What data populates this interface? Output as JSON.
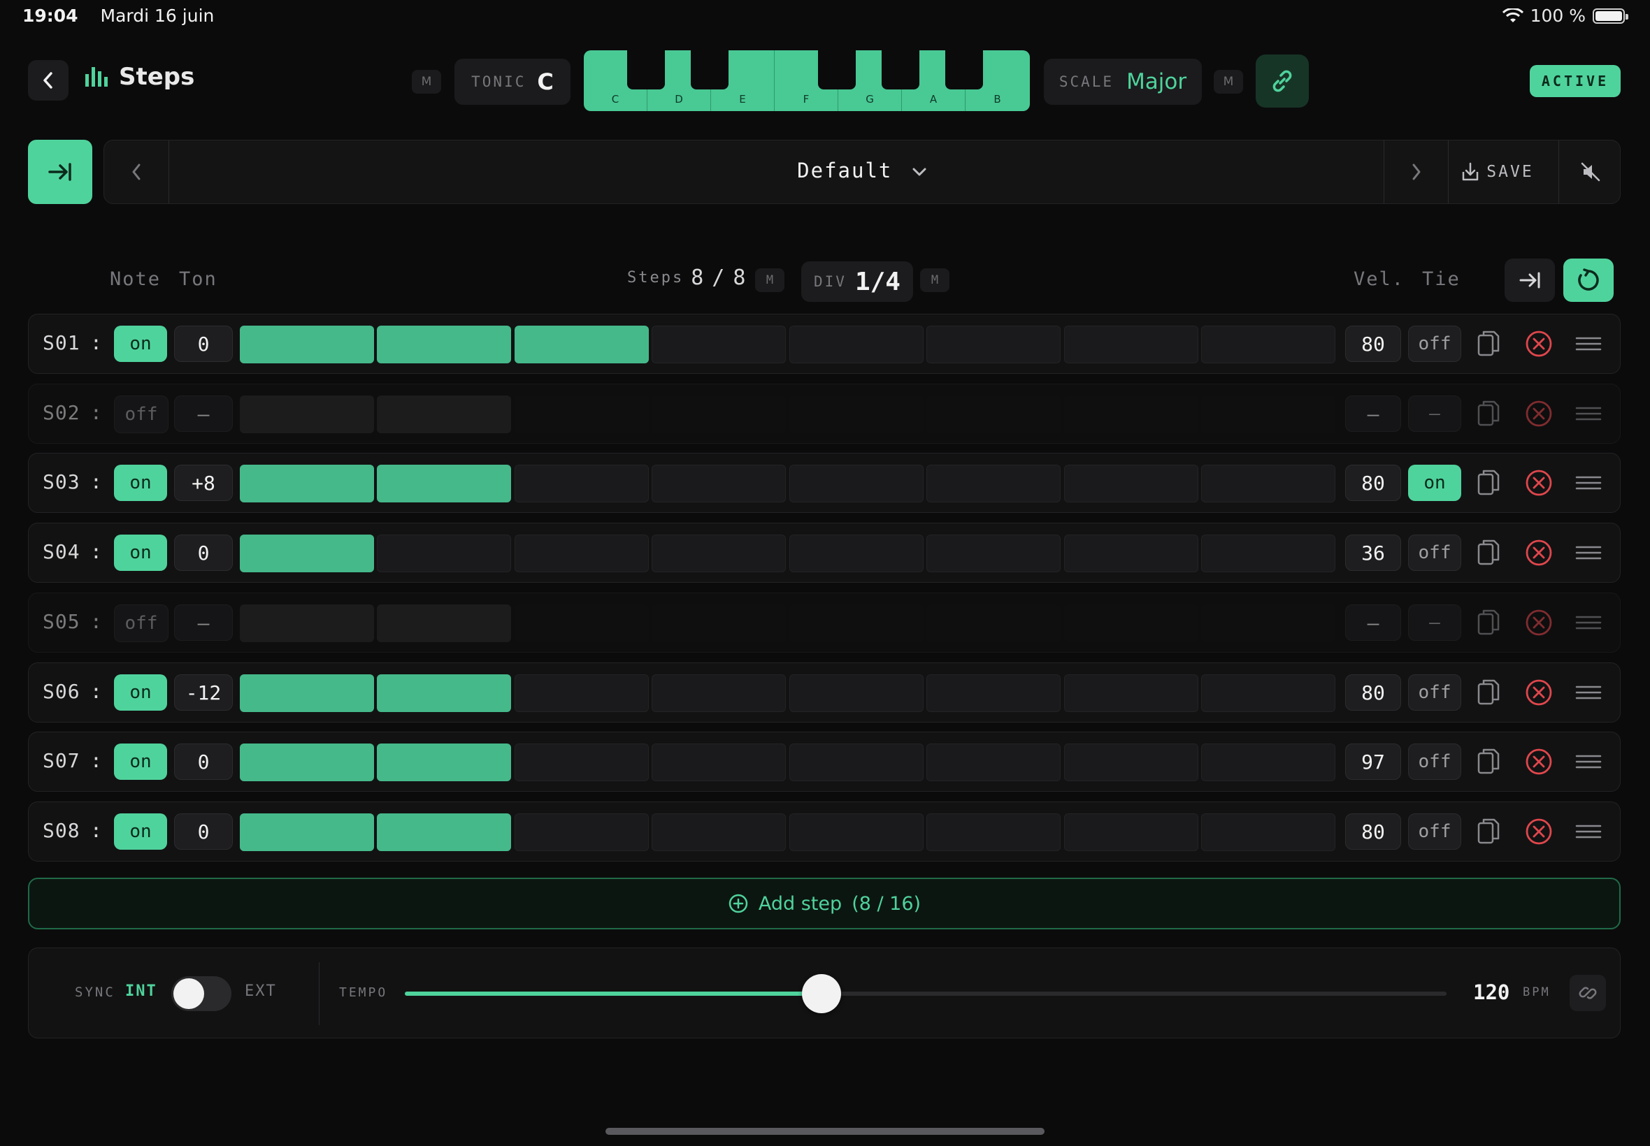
{
  "status_bar": {
    "time": "19:04",
    "date": "Mardi 16 juin",
    "battery": "100 %"
  },
  "header": {
    "title": "Steps",
    "tonic_m": "M",
    "tonic_label": "TONIC",
    "tonic_value": "C",
    "keys": [
      "C",
      "D",
      "E",
      "F",
      "G",
      "A",
      "B"
    ],
    "scale_label": "SCALE",
    "scale_value": "Major",
    "scale_m": "M",
    "status": "ACTIVE"
  },
  "preset": {
    "name": "Default",
    "save_label": "SAVE"
  },
  "columns": {
    "note": "Note",
    "ton": "Ton",
    "steps_label": "Steps",
    "steps_current": "8",
    "steps_sep": "/",
    "steps_total": "8",
    "steps_m": "M",
    "div_label": "DIV",
    "div_value": "1/4",
    "div_m": "M",
    "vel": "Vel.",
    "tie": "Tie"
  },
  "steps": [
    {
      "id": "S01",
      "sep": ":",
      "state": "on",
      "ton": "0",
      "length": 3,
      "vel": "80",
      "tie": "off"
    },
    {
      "id": "S02",
      "sep": ":",
      "state": "off",
      "ton": "–",
      "length": 2,
      "vel": "–",
      "tie": "–"
    },
    {
      "id": "S03",
      "sep": ":",
      "state": "on",
      "ton": "+8",
      "length": 2,
      "vel": "80",
      "tie": "on"
    },
    {
      "id": "S04",
      "sep": ":",
      "state": "on",
      "ton": "0",
      "length": 1,
      "vel": "36",
      "tie": "off"
    },
    {
      "id": "S05",
      "sep": ":",
      "state": "off",
      "ton": "–",
      "length": 2,
      "vel": "–",
      "tie": "–"
    },
    {
      "id": "S06",
      "sep": ":",
      "state": "on",
      "ton": "-12",
      "length": 2,
      "vel": "80",
      "tie": "off"
    },
    {
      "id": "S07",
      "sep": ":",
      "state": "on",
      "ton": "0",
      "length": 2,
      "vel": "97",
      "tie": "off"
    },
    {
      "id": "S08",
      "sep": ":",
      "state": "on",
      "ton": "0",
      "length": 2,
      "vel": "80",
      "tie": "off"
    }
  ],
  "add_step": {
    "label": "Add step",
    "count": "(8 / 16)"
  },
  "transport": {
    "sync_label": "SYNC",
    "sync_int": "INT",
    "sync_ext": "EXT",
    "tempo_label": "TEMPO",
    "tempo_fraction": 0.4,
    "bpm": "120",
    "bpm_unit": "BPM"
  },
  "colors": {
    "accent": "#4fd39c",
    "bar_fill": "#45b98a",
    "delete": "#e0474c",
    "background": "#0b0b0c"
  }
}
